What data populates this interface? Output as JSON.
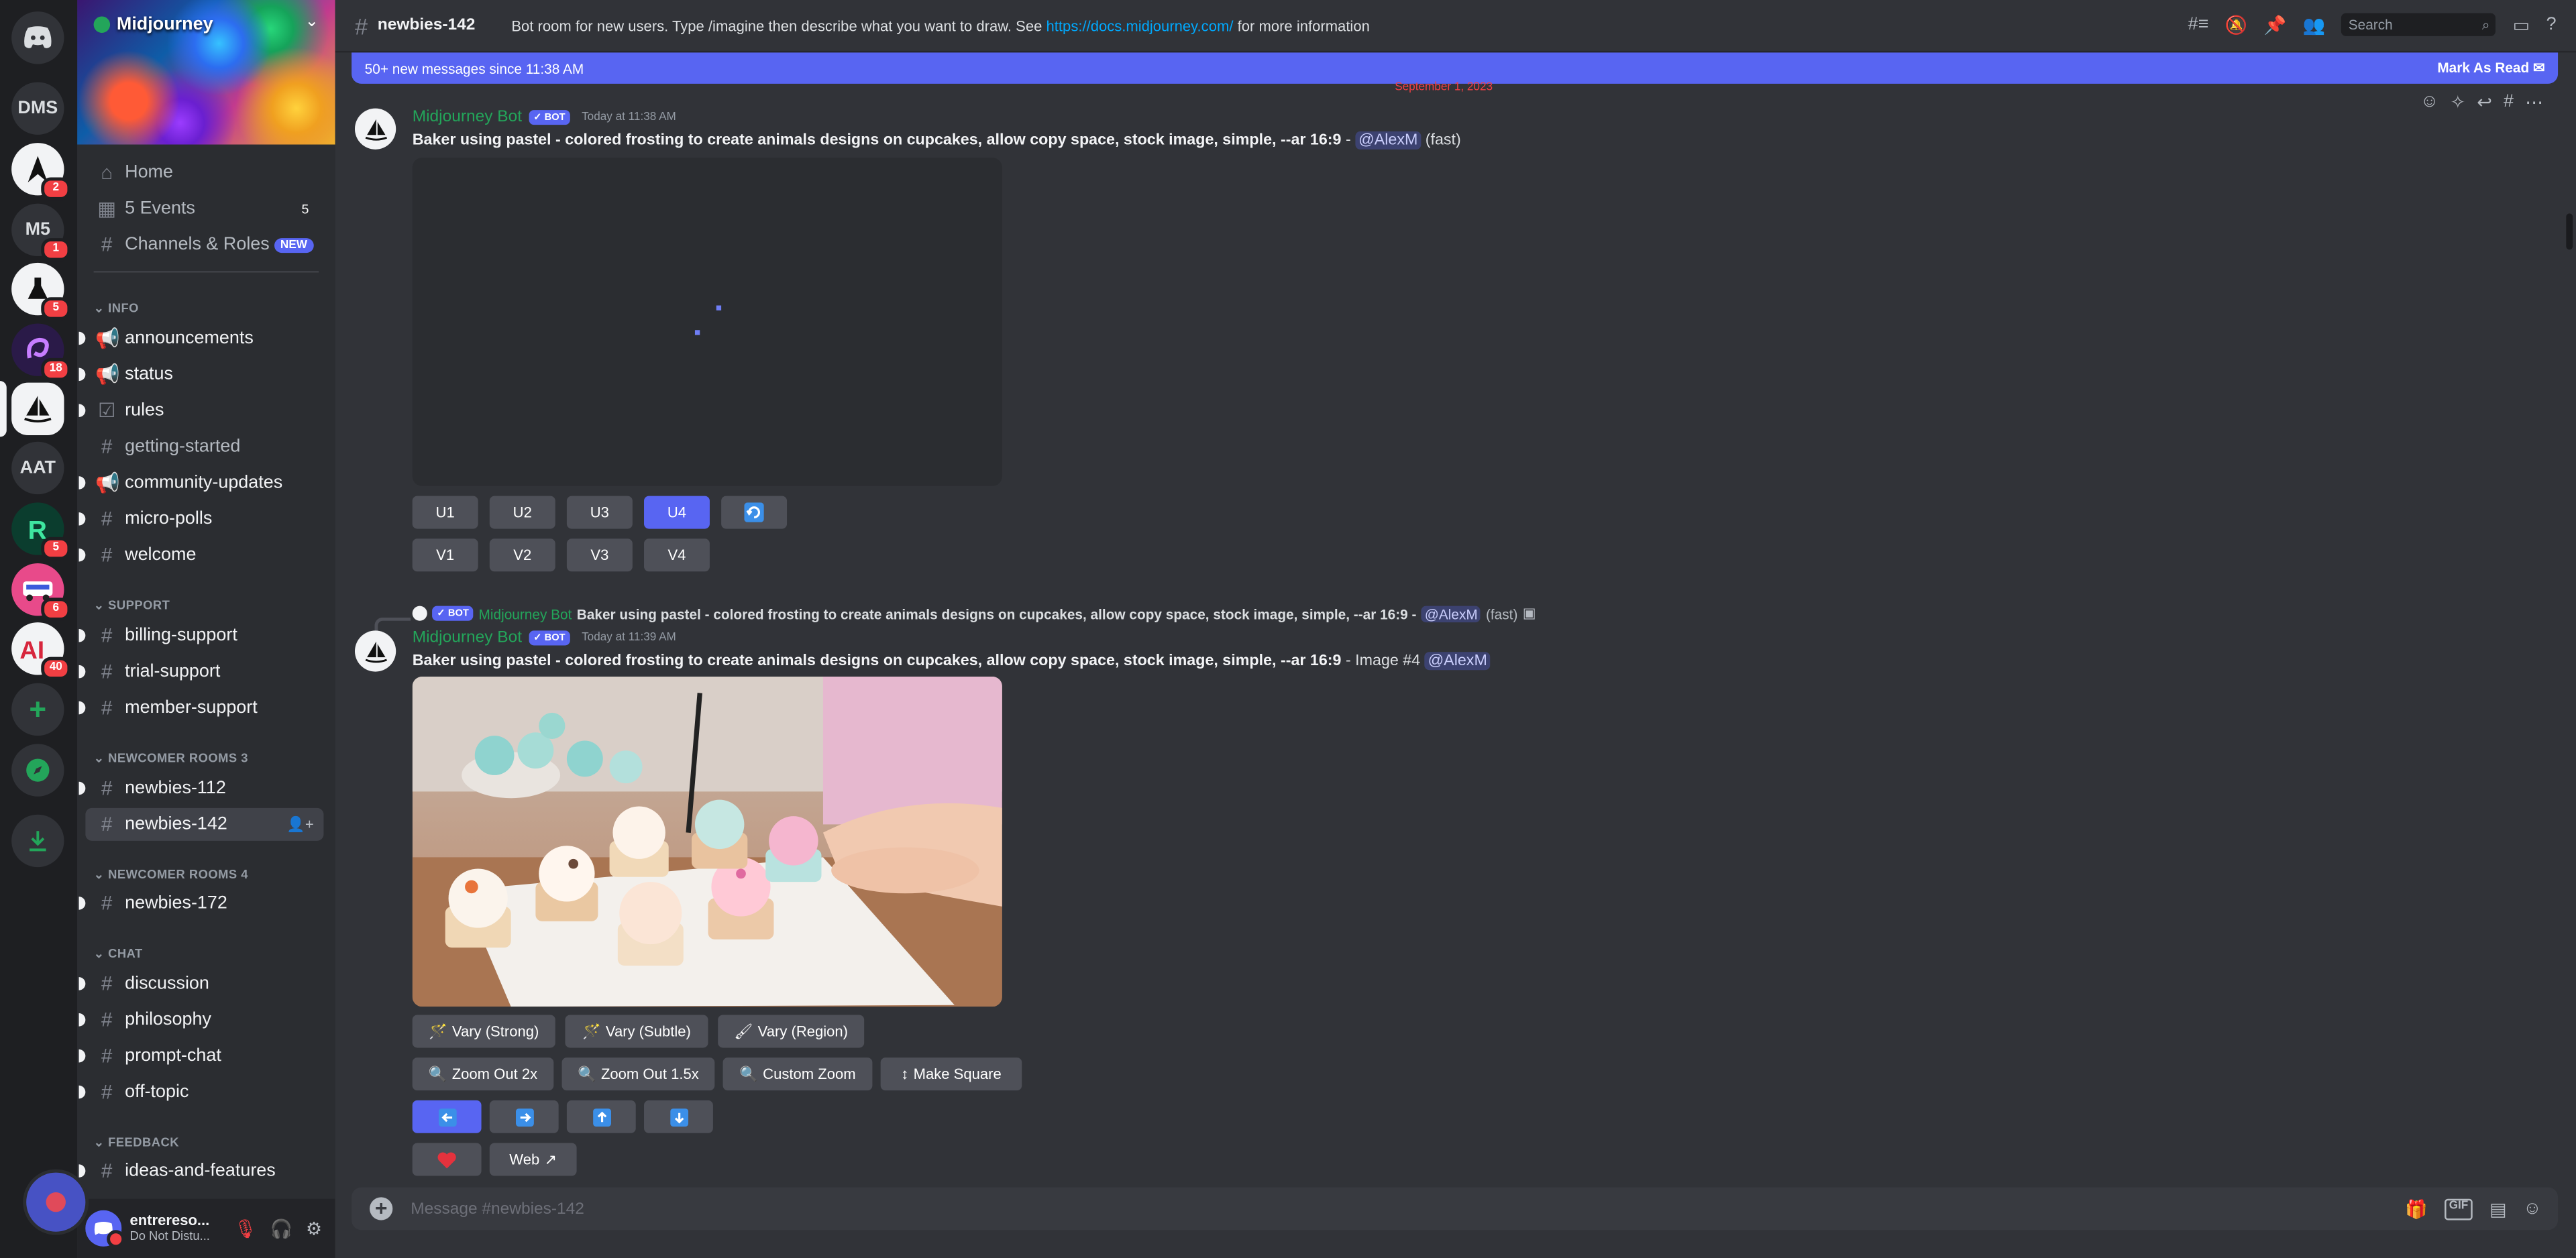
{
  "rail": {
    "dms_label": "DMS",
    "m5_label": "M5",
    "aat_label": "AAT",
    "badges": {
      "b1": "2",
      "b2": "1",
      "b3": "5",
      "b4": "18",
      "b5": "5",
      "b6": "6",
      "b7": "40"
    }
  },
  "server": {
    "name": "Midjourney"
  },
  "sidebar": {
    "home": "Home",
    "events": "5 Events",
    "events_count": "5",
    "channels_roles": "Channels & Roles",
    "new_badge": "NEW",
    "categories": {
      "info": "INFO",
      "support": "SUPPORT",
      "newcomer3": "NEWCOMER ROOMS 3",
      "newcomer4": "NEWCOMER ROOMS 4",
      "chat": "CHAT",
      "feedback": "FEEDBACK"
    },
    "channels": {
      "announcements": "announcements",
      "status": "status",
      "rules": "rules",
      "getting_started": "getting-started",
      "community_updates": "community-updates",
      "micro_polls": "micro-polls",
      "welcome": "welcome",
      "billing_support": "billing-support",
      "trial_support": "trial-support",
      "member_support": "member-support",
      "newbies_112": "newbies-112",
      "newbies_142": "newbies-142",
      "newbies_172": "newbies-172",
      "discussion": "discussion",
      "philosophy": "philosophy",
      "prompt_chat": "prompt-chat",
      "off_topic": "off-topic",
      "ideas_features": "ideas-and-features"
    }
  },
  "user": {
    "name": "entrereso...",
    "status": "Do Not Distu..."
  },
  "header": {
    "channel": "newbies-142",
    "topic_pre": "Bot room for new users. Type /imagine then describe what you want to draw. See",
    "topic_link": "https://docs.midjourney.com/",
    "topic_post": "for more information",
    "search_placeholder": "Search"
  },
  "newbar": {
    "text": "50+ new messages since 11:38 AM",
    "mark": "Mark As Read"
  },
  "date_sep": "September 1, 2023",
  "msg1": {
    "author": "Midjourney Bot",
    "bot_tag": "✓ BOT",
    "time": "Today at 11:38 AM",
    "prompt": "Baker using pastel - colored frosting to create animals designs on cupcakes, allow copy space, stock image, simple, --ar 16:9",
    "dash": " - ",
    "mention": "@AlexM",
    "suffix": " (fast)",
    "buttons": [
      "U1",
      "U2",
      "U3",
      "U4",
      "V1",
      "V2",
      "V3",
      "V4"
    ],
    "refresh_icon": "refresh-icon"
  },
  "msg2": {
    "reply_author": "Midjourney Bot",
    "reply_text": "Baker using pastel - colored frosting to create animals designs on cupcakes, allow copy space, stock image, simple, --ar 16:9 -",
    "reply_mention": "@AlexM",
    "reply_suffix": "(fast)",
    "author": "Midjourney Bot",
    "bot_tag": "✓ BOT",
    "time": "Today at 11:39 AM",
    "prompt": "Baker using pastel - colored frosting to create animals designs on cupcakes, allow copy space, stock image, simple, --ar 16:9",
    "image_label": " - Image #4 ",
    "mention": "@AlexM",
    "vary_strong": "Vary (Strong)",
    "vary_subtle": "Vary (Subtle)",
    "vary_region": "Vary (Region)",
    "zoom2": "Zoom Out 2x",
    "zoom15": "Zoom Out 1.5x",
    "custom_zoom": "Custom Zoom",
    "make_square": "Make Square",
    "web": "Web"
  },
  "composer": {
    "placeholder": "Message #newbies-142"
  },
  "colors": {
    "accent": "#5865f2",
    "green": "#23a55a",
    "red": "#f23f43",
    "link": "#00a8fc"
  }
}
